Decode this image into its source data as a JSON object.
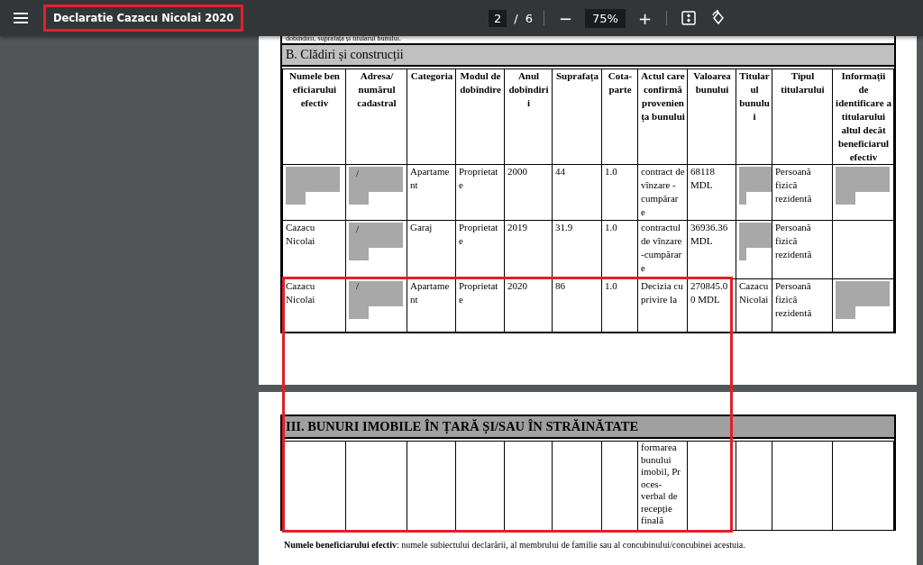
{
  "toolbar": {
    "title": "Declaratie Cazacu Nicolai 2020",
    "title_highlighted": true,
    "page": "2",
    "page_separator": "/",
    "page_count": "6",
    "zoom_out": "−",
    "zoom": "75%",
    "zoom_in": "+"
  },
  "page_1": {
    "cut_line": "dobîndirii, suprafața și titularul bunului.",
    "section_title": "B. Clădiri și construcții",
    "columns": [
      "Numele ben eficiarului efectiv",
      "Adresa/ numărul cadastral",
      "Categoria",
      "Modul de dobîndire",
      "Anul dobîndirii",
      "Suprafața",
      "Cota-parte",
      "Actul care confirmă provenien ța bunului",
      "Valoarea bunului",
      "Titular ul bunulu i",
      "Tipul titularului",
      "Informații de identificare a titularului altul decât beneficiarul efectiv"
    ],
    "rows": [
      {
        "cells": [
          {
            "redacted": true
          },
          {
            "redacted": true,
            "text": "/"
          },
          "Apartame nt",
          "Proprietat e",
          "2000",
          "44",
          "1.0",
          "contract de vînzare -cumpărar e",
          "68118 MDL",
          {
            "redacted": true
          },
          "Persoană fizică rezidentă",
          {
            "redacted": true
          }
        ]
      },
      {
        "cells": [
          "Cazacu Nicolai",
          {
            "redacted": true,
            "text": "/"
          },
          "Garaj",
          "Proprietat e",
          "2019",
          "31.9",
          "1.0",
          "contractul de vînzare -cumpărar e",
          "36936.36 MDL",
          {
            "redacted": true
          },
          "Persoană fizică rezidentă"
        ]
      },
      {
        "cells": [
          "Cazacu Nicolai",
          {
            "redacted": true,
            "text": "/"
          },
          "Apartame nt",
          "Proprietat e",
          "2020",
          "86",
          "1.0",
          "Decizia cu privire la",
          "270845.0 0 MDL",
          "Cazacu Nicolai",
          "Persoană fizică rezidentă",
          {
            "redacted": true
          }
        ]
      }
    ]
  },
  "page_2": {
    "section_title": "III. BUNURI IMOBILE ÎN ȚARĂ ȘI/SAU ÎN STRĂINĂTATE",
    "continued_cell": {
      "text": "formarea bunului imobil, Pr oces-verbal de recepție finală"
    },
    "footnote": "**Numele beneficiarului efectiv**: numele subiectului declarării, al membrului de familie sau al concubinului/concubinei acestuia."
  },
  "table_highlighted": true
}
